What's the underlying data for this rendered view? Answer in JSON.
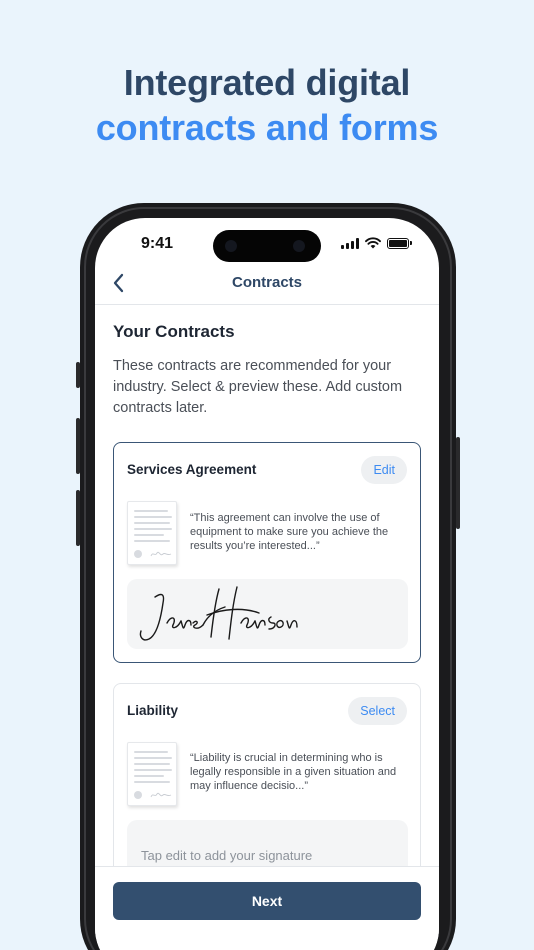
{
  "headline": {
    "line1": "Integrated digital",
    "line2": "contracts and forms"
  },
  "status_bar": {
    "time": "9:41",
    "icons": [
      "cellular-signal-icon",
      "wifi-icon",
      "battery-icon"
    ]
  },
  "navbar": {
    "title": "Contracts",
    "back_icon": "chevron-left-icon"
  },
  "section": {
    "title": "Your Contracts",
    "description": "These contracts are recommended for your industry. Select & preview these. Add custom contracts later."
  },
  "contracts": [
    {
      "title": "Services Agreement",
      "action_label": "Edit",
      "excerpt": "“This agreement can involve the use of equipment to make sure you achieve the results you’re interested...”",
      "signature": "Jane Hanson",
      "selected": true
    },
    {
      "title": "Liability",
      "action_label": "Select",
      "excerpt": "“Liability is crucial in determining who is legally responsible in a given situation and may influence decisio...”",
      "signature_placeholder": "Tap edit to add your signature",
      "selected": false
    }
  ],
  "footer": {
    "next_label": "Next"
  },
  "colors": {
    "background": "#eaf4fc",
    "headline_dark": "#2e4766",
    "headline_accent": "#3d8bf2",
    "primary_button": "#334f6f",
    "link": "#3d8bf2"
  }
}
